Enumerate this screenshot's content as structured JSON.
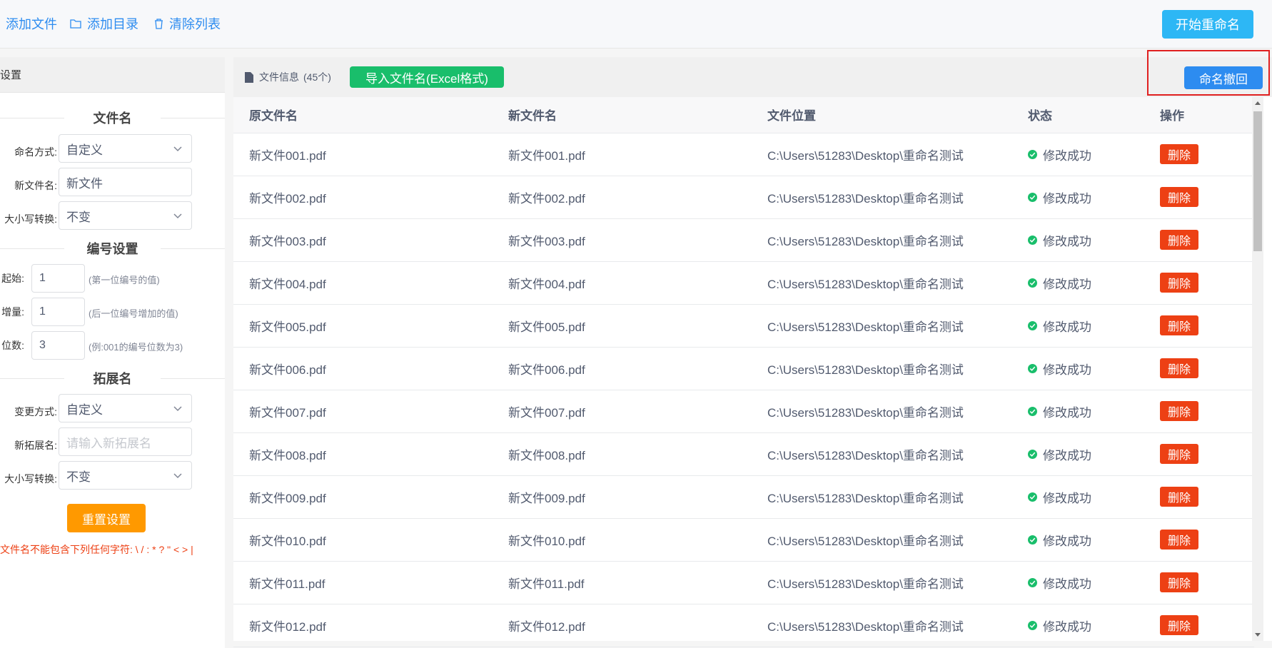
{
  "toolbar": {
    "add_file": "添加文件",
    "add_dir": "添加目录",
    "clear_list": "清除列表",
    "start_rename": "开始重命名"
  },
  "left": {
    "header": "设置",
    "filename_section": "文件名",
    "naming_method_label": "命名方式:",
    "naming_method_value": "自定义",
    "new_filename_label": "新文件名:",
    "new_filename_value": "新文件",
    "case_label": "大小写转换:",
    "case_value": "不变",
    "numbering_section": "编号设置",
    "start_label": "起始:",
    "start_value": "1",
    "start_hint": "(第一位编号的值)",
    "step_label": "增量:",
    "step_value": "1",
    "step_hint": "(后一位编号增加的值)",
    "digits_label": "位数:",
    "digits_value": "3",
    "digits_hint": "(例:001的编号位数为3)",
    "ext_section": "拓展名",
    "change_method_label": "变更方式:",
    "change_method_value": "自定义",
    "new_ext_label": "新拓展名:",
    "new_ext_placeholder": "请输入新拓展名",
    "ext_case_label": "大小写转换:",
    "ext_case_value": "不变",
    "reset_button": "重置设置",
    "warning": "文件名不能包含下列任何字符: \\ / : * ? \" < > |"
  },
  "main": {
    "info_label": "文件信息",
    "count": "(45个)",
    "import_button": "导入文件名(Excel格式)",
    "undo_button": "命名撤回",
    "columns": [
      "原文件名",
      "新文件名",
      "文件位置",
      "状态",
      "操作"
    ],
    "delete_label": "删除",
    "rows": [
      {
        "orig": "新文件001.pdf",
        "new": "新文件001.pdf",
        "path": "C:\\Users\\51283\\Desktop\\重命名测试",
        "status": "修改成功"
      },
      {
        "orig": "新文件002.pdf",
        "new": "新文件002.pdf",
        "path": "C:\\Users\\51283\\Desktop\\重命名测试",
        "status": "修改成功"
      },
      {
        "orig": "新文件003.pdf",
        "new": "新文件003.pdf",
        "path": "C:\\Users\\51283\\Desktop\\重命名测试",
        "status": "修改成功"
      },
      {
        "orig": "新文件004.pdf",
        "new": "新文件004.pdf",
        "path": "C:\\Users\\51283\\Desktop\\重命名测试",
        "status": "修改成功"
      },
      {
        "orig": "新文件005.pdf",
        "new": "新文件005.pdf",
        "path": "C:\\Users\\51283\\Desktop\\重命名测试",
        "status": "修改成功"
      },
      {
        "orig": "新文件006.pdf",
        "new": "新文件006.pdf",
        "path": "C:\\Users\\51283\\Desktop\\重命名测试",
        "status": "修改成功"
      },
      {
        "orig": "新文件007.pdf",
        "new": "新文件007.pdf",
        "path": "C:\\Users\\51283\\Desktop\\重命名测试",
        "status": "修改成功"
      },
      {
        "orig": "新文件008.pdf",
        "new": "新文件008.pdf",
        "path": "C:\\Users\\51283\\Desktop\\重命名测试",
        "status": "修改成功"
      },
      {
        "orig": "新文件009.pdf",
        "new": "新文件009.pdf",
        "path": "C:\\Users\\51283\\Desktop\\重命名测试",
        "status": "修改成功"
      },
      {
        "orig": "新文件010.pdf",
        "new": "新文件010.pdf",
        "path": "C:\\Users\\51283\\Desktop\\重命名测试",
        "status": "修改成功"
      },
      {
        "orig": "新文件011.pdf",
        "new": "新文件011.pdf",
        "path": "C:\\Users\\51283\\Desktop\\重命名测试",
        "status": "修改成功"
      },
      {
        "orig": "新文件012.pdf",
        "new": "新文件012.pdf",
        "path": "C:\\Users\\51283\\Desktop\\重命名测试",
        "status": "修改成功"
      }
    ]
  },
  "colors": {
    "primary": "#2d8cf0",
    "success": "#19be6b",
    "warning": "#ff9900",
    "danger": "#ed4014",
    "info": "#2db7f5"
  },
  "icons": {
    "add_dir": "folder-icon",
    "clear_list": "trash-icon",
    "info": "file-icon",
    "status": "check-circle-icon",
    "select": "chevron-down-icon"
  }
}
